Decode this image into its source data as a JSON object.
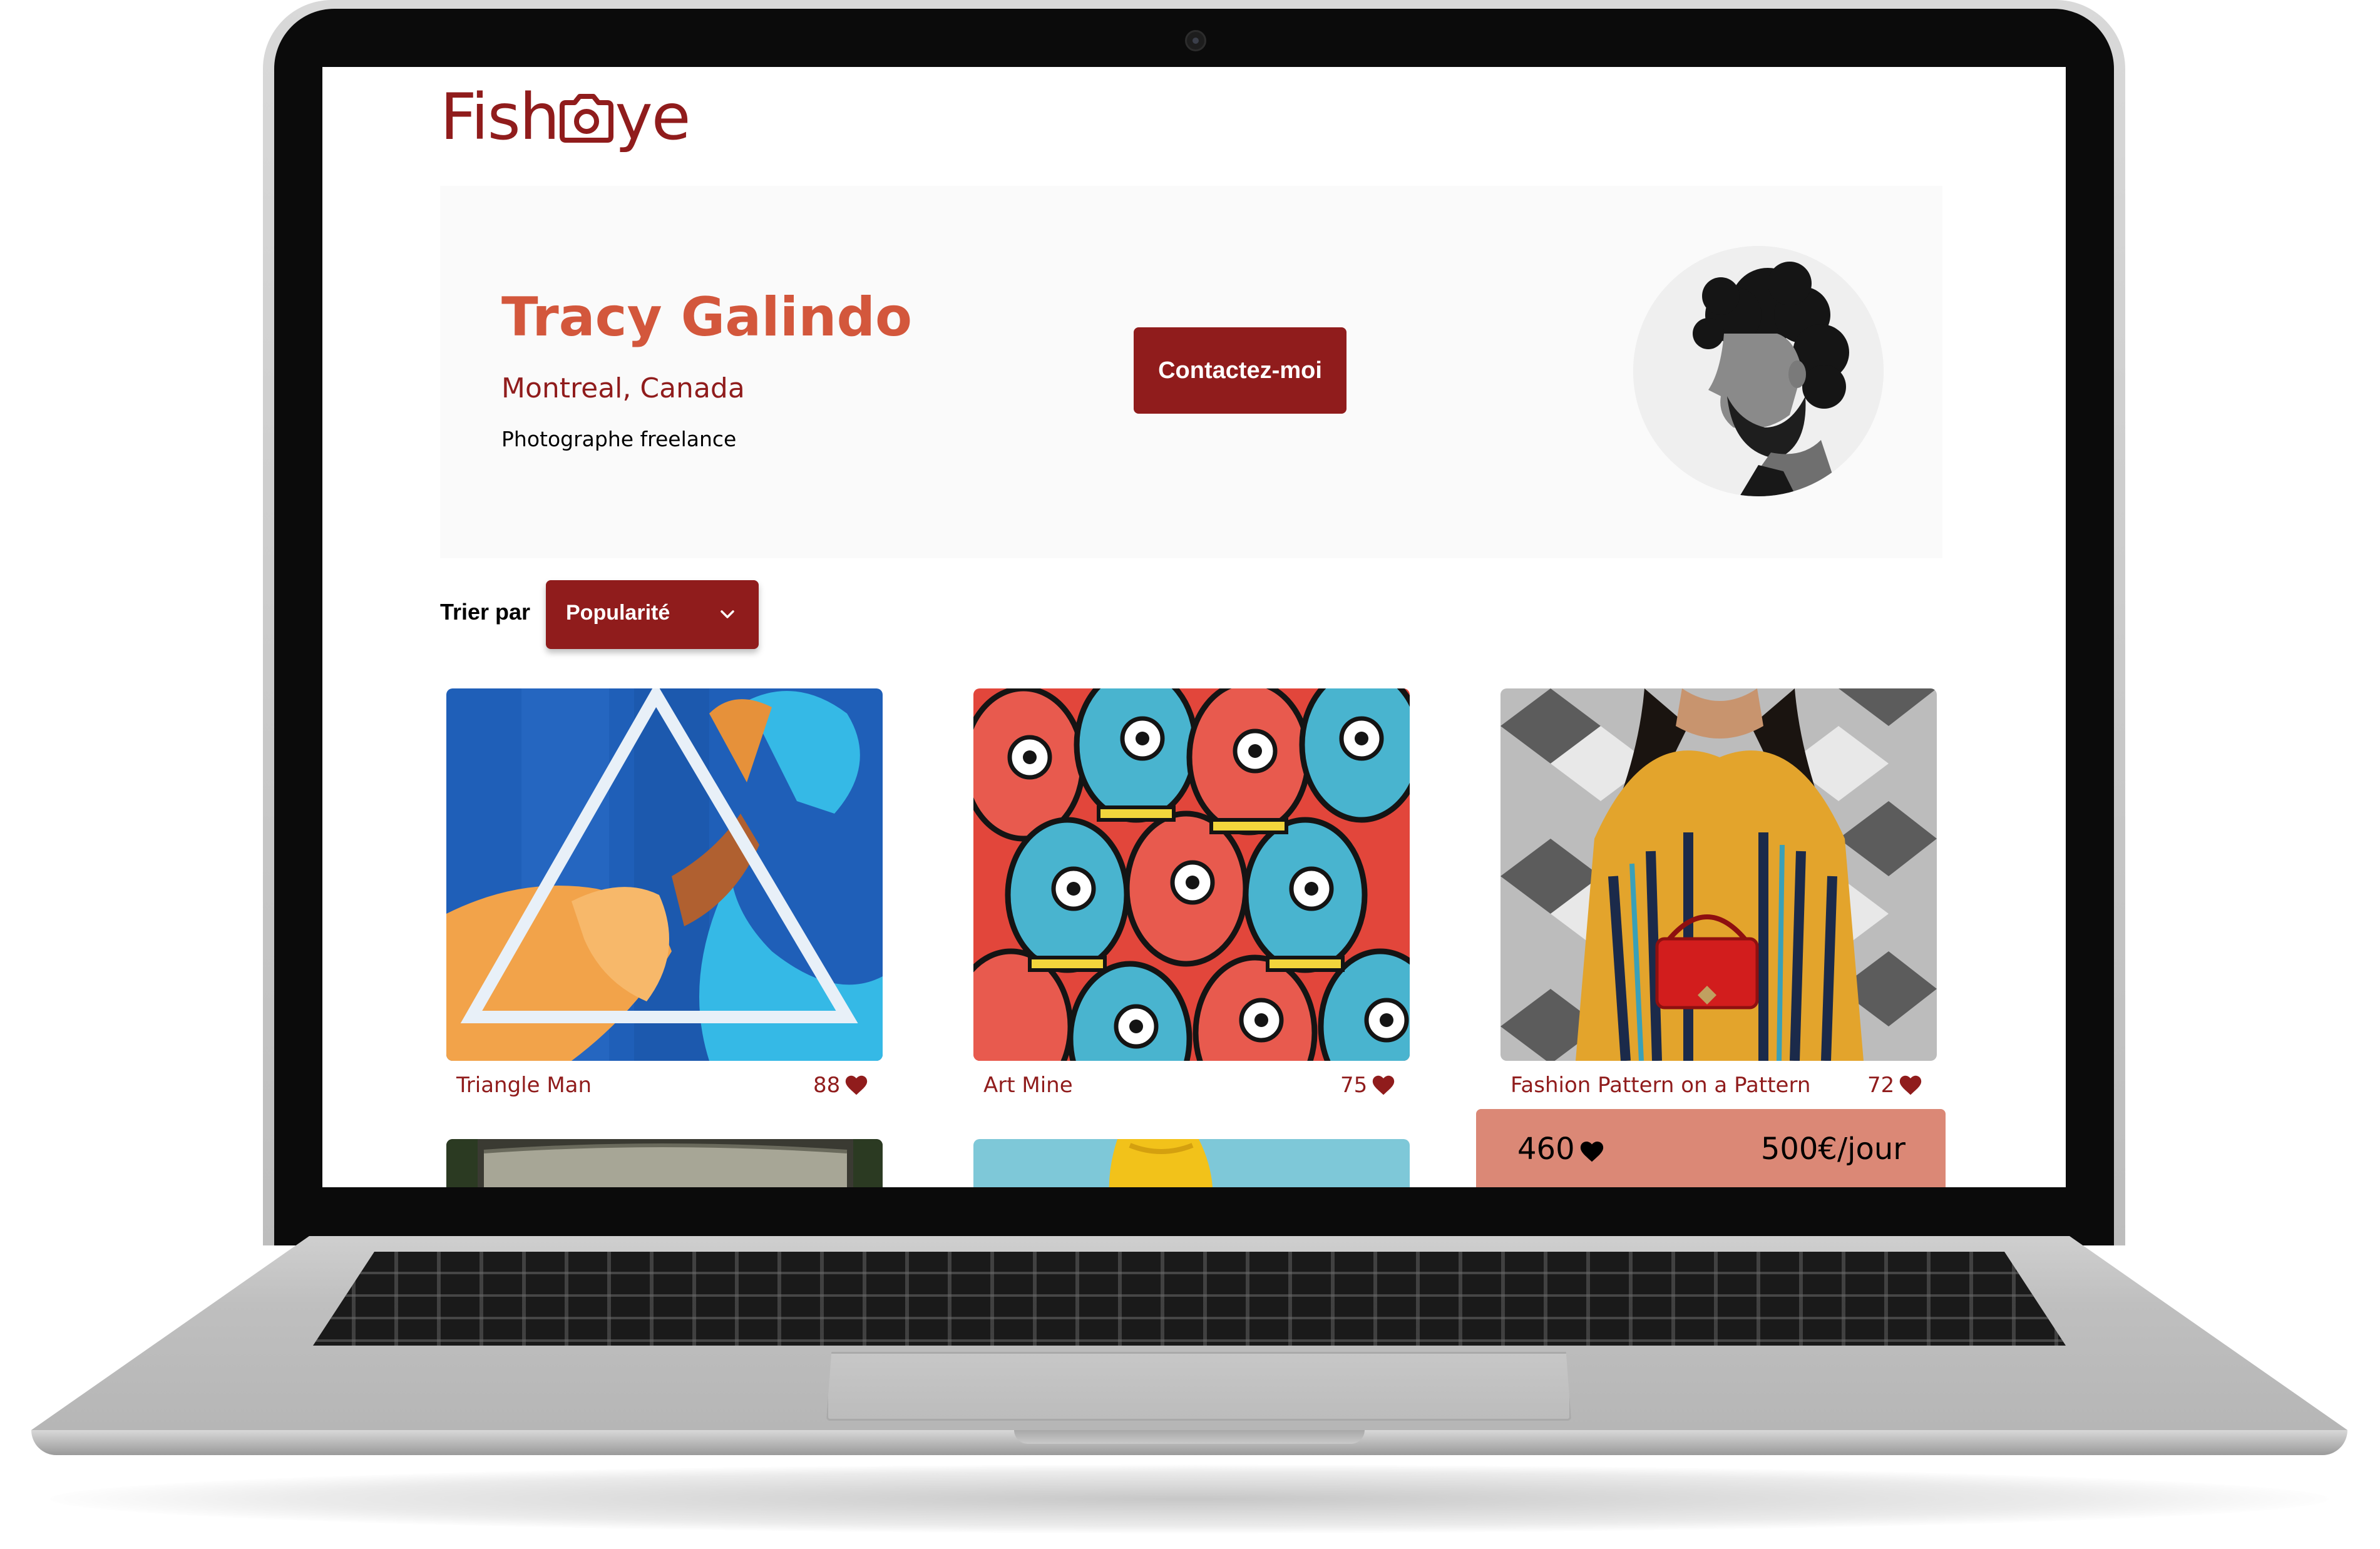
{
  "app": {
    "logo_text_left": "Fish",
    "logo_text_right": "ye",
    "brand_color": "#901C1C",
    "accent_color": "#D3573C"
  },
  "photographer": {
    "name": "Tracy Galindo",
    "location": "Montreal, Canada",
    "tagline": "Photographe freelance",
    "contact_label": "Contactez-moi"
  },
  "sort": {
    "label": "Trier par",
    "selected": "Popularité"
  },
  "media": [
    {
      "title": "Triangle Man",
      "likes": "88"
    },
    {
      "title": "Art Mine",
      "likes": "75"
    },
    {
      "title": "Fashion Pattern on a Pattern",
      "likes": "72"
    }
  ],
  "stats": {
    "total_likes": "460",
    "price": "500€/jour"
  },
  "icons": [
    "camera-logo-icon",
    "chevron-down-icon",
    "heart-icon"
  ]
}
